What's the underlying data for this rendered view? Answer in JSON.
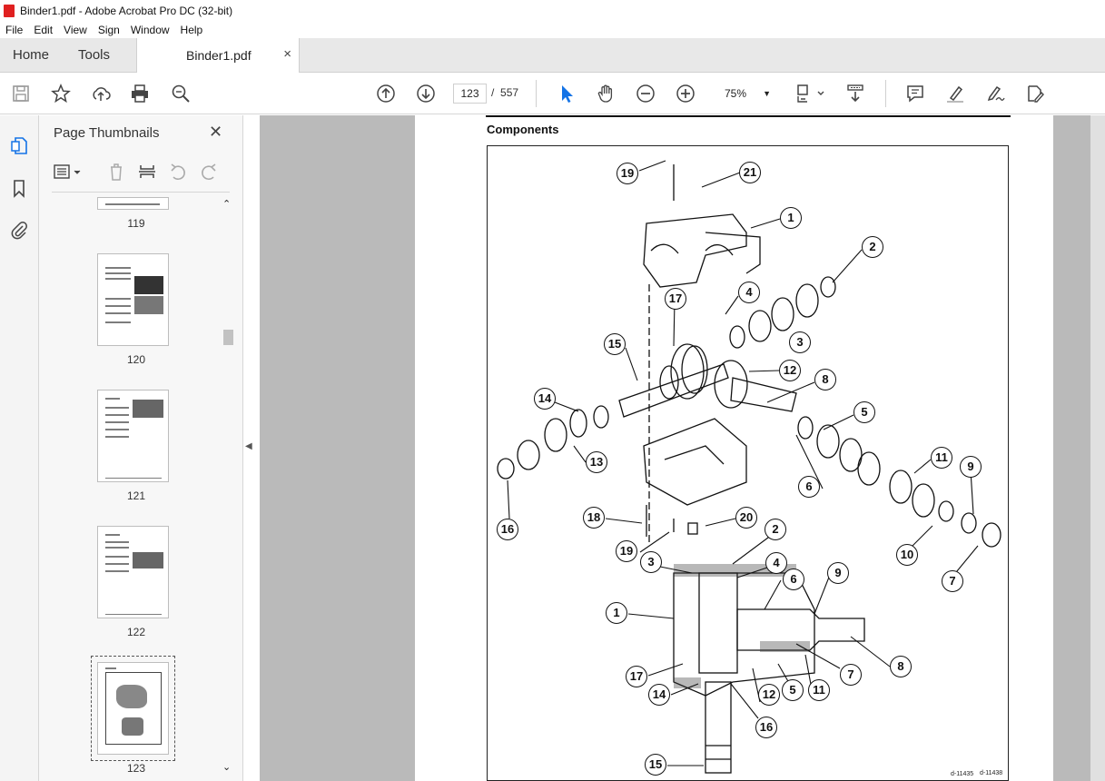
{
  "window": {
    "title": "Binder1.pdf - Adobe Acrobat Pro DC (32-bit)"
  },
  "menu": [
    "File",
    "Edit",
    "View",
    "Sign",
    "Window",
    "Help"
  ],
  "tabs": {
    "home": "Home",
    "tools": "Tools",
    "document": "Binder1.pdf",
    "close": "×"
  },
  "toolbar": {
    "current_page": "123",
    "page_separator": "/",
    "total_pages": "557",
    "zoom": "75%",
    "zoom_dropdown": "▼"
  },
  "panel": {
    "title": "Page Thumbnails",
    "close": "✕",
    "thumbnails": [
      "119",
      "120",
      "121",
      "122",
      "123"
    ],
    "selected": "123"
  },
  "page": {
    "heading": "Components"
  },
  "figure": {
    "callouts_top": [
      "19",
      "21",
      "1",
      "2",
      "17",
      "4",
      "15",
      "3",
      "12",
      "8",
      "14",
      "5",
      "13",
      "11",
      "9",
      "6",
      "16",
      "18",
      "20",
      "19",
      "10",
      "7"
    ],
    "callouts_bottom": [
      "2",
      "3",
      "4",
      "6",
      "9",
      "1",
      "7",
      "8",
      "17",
      "14",
      "12",
      "5",
      "11",
      "16",
      "15"
    ],
    "ids": [
      "d-11435",
      "d-11438"
    ]
  }
}
